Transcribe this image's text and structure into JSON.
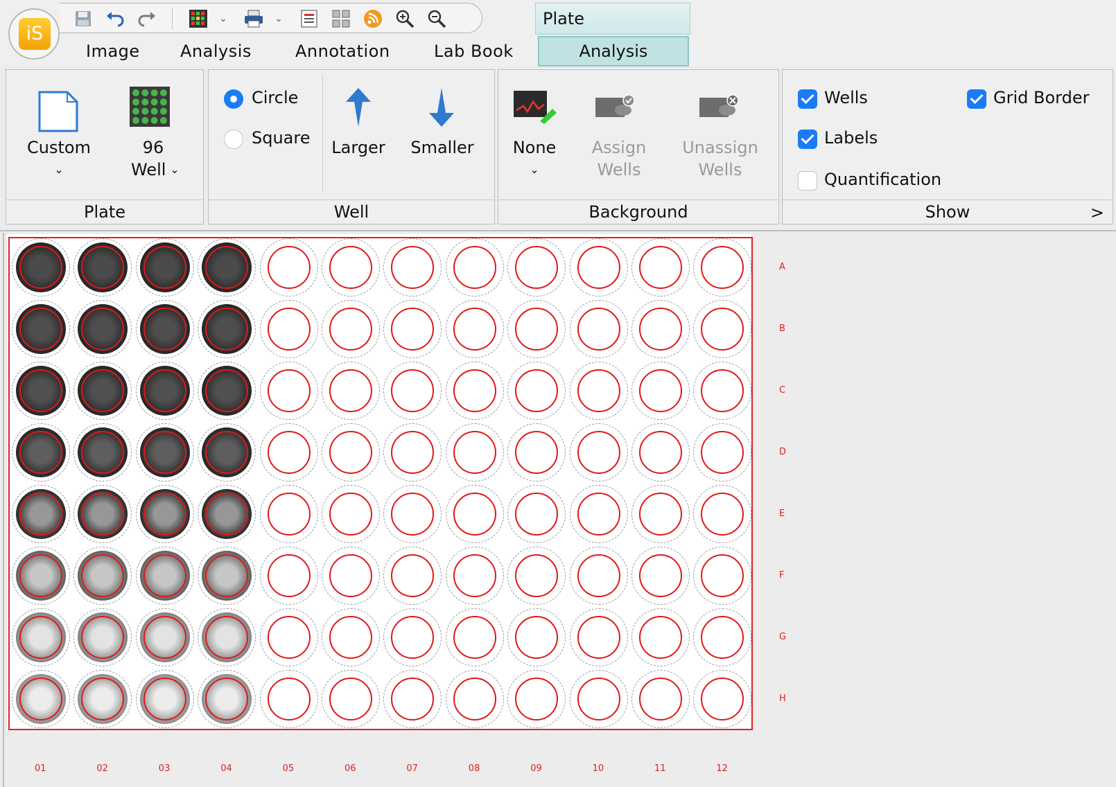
{
  "app": {
    "logo_text": "iS",
    "menu_tabs": [
      "Image",
      "Analysis",
      "Annotation",
      "Lab Book"
    ],
    "context_group": "Plate",
    "context_tab": "Analysis",
    "quick_access": [
      "save-icon",
      "undo-icon",
      "redo-icon",
      "color-grid-icon",
      "print-icon",
      "report-icon",
      "layout-icon",
      "rss-icon",
      "zoom-in-icon",
      "zoom-out-icon"
    ]
  },
  "ribbon": {
    "plate": {
      "group_label": "Plate",
      "custom_label": "Custom",
      "well96_line1": "96",
      "well96_line2": "Well"
    },
    "well": {
      "group_label": "Well",
      "circle_label": "Circle",
      "square_label": "Square",
      "shape_selected": "Circle",
      "larger_label": "Larger",
      "smaller_label": "Smaller"
    },
    "background": {
      "group_label": "Background",
      "none_label": "None",
      "assign_line1": "Assign",
      "assign_line2": "Wells",
      "unassign_line1": "Unassign",
      "unassign_line2": "Wells"
    },
    "show": {
      "group_label": "Show",
      "expand_glyph": ">",
      "wells_label": "Wells",
      "wells_checked": true,
      "grid_border_label": "Grid Border",
      "grid_border_checked": true,
      "labels_label": "Labels",
      "labels_checked": true,
      "quantification_label": "Quantification",
      "quantification_checked": false
    }
  },
  "plate": {
    "rows": [
      "A",
      "B",
      "C",
      "D",
      "E",
      "F",
      "G",
      "H"
    ],
    "columns": [
      "01",
      "02",
      "03",
      "04",
      "05",
      "06",
      "07",
      "08",
      "09",
      "10",
      "11",
      "12"
    ],
    "filled_columns": 4,
    "filled_intensity_by_row": [
      0.95,
      0.93,
      0.92,
      0.85,
      0.55,
      0.3,
      0.15,
      0.1
    ],
    "circle_color": "#e01818",
    "label_color": "#e02020"
  }
}
